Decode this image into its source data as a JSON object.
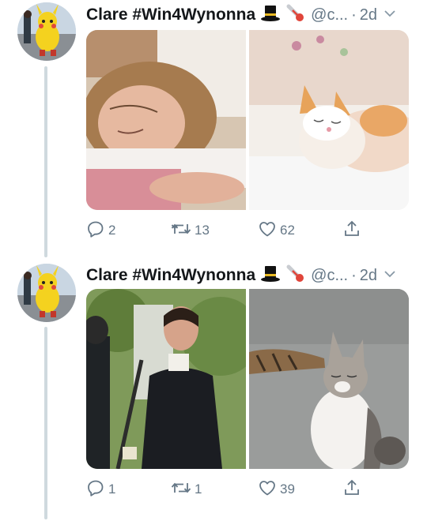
{
  "tweets": [
    {
      "author": "Clare #Win4Wynonna",
      "handle": "@c...",
      "separator": "·",
      "time": "2d",
      "emojis": [
        "top-hat",
        "thermometer"
      ],
      "media": [
        "woman-sleeping-photo",
        "cat-sleeping-photo"
      ],
      "replies": "2",
      "retweets": "13",
      "likes": "62"
    },
    {
      "author": "Clare #Win4Wynonna",
      "handle": "@c...",
      "separator": "·",
      "time": "2d",
      "emojis": [
        "top-hat",
        "thermometer"
      ],
      "media": [
        "period-drama-couple-photo",
        "cat-paw-on-head-photo"
      ],
      "replies": "1",
      "retweets": "1",
      "likes": "39"
    }
  ],
  "colors": {
    "text": "#14171a",
    "muted": "#657786",
    "thread": "#cfd9de"
  }
}
